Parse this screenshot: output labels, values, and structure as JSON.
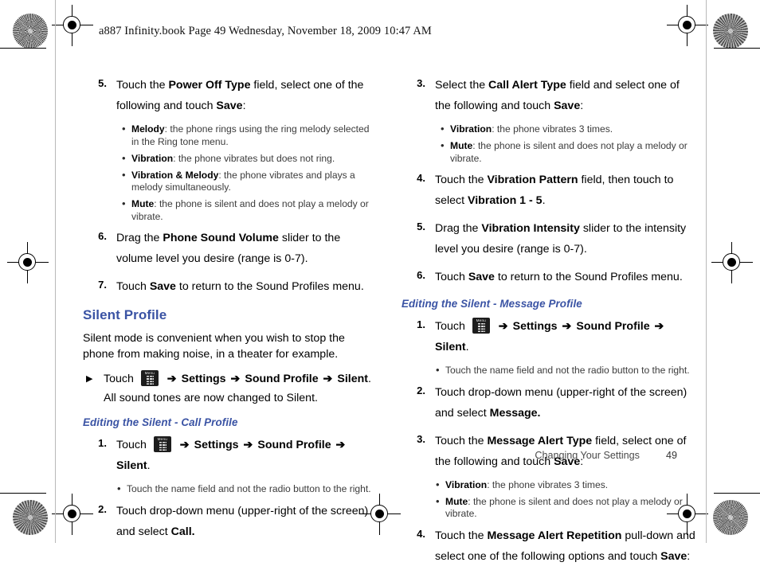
{
  "document": {
    "header": "a887 Infinity.book  Page 49  Wednesday, November 18, 2009  10:47 AM",
    "footer_title": "Changing Your Settings",
    "page_number": "49",
    "accent_color": "#3a53a4"
  },
  "left_column": {
    "steps": [
      {
        "num": "5.",
        "text_html": "Touch the <b class=\"bk\">Power Off Type</b> field, select one of the following and touch <b class=\"bk\">Save</b>:",
        "bullets": [
          {
            "term": "Melody",
            "desc": ": the phone rings using the ring melody selected in the Ring tone menu."
          },
          {
            "term": "Vibration",
            "desc": ": the phone vibrates but does not ring."
          },
          {
            "term": "Vibration & Melody",
            "desc": ": the phone vibrates and plays a melody simultaneously."
          },
          {
            "term": "Mute",
            "desc": ": the phone is silent and does not play a melody or vibrate."
          }
        ]
      },
      {
        "num": "6.",
        "text_html": "Drag the <b class=\"bk\">Phone Sound Volume</b> slider to the volume level you desire (range is 0-7).",
        "bullets": []
      },
      {
        "num": "7.",
        "text_html": "Touch <b class=\"bk\">Save</b> to return to the Sound Profiles menu.",
        "bullets": []
      }
    ],
    "silent_profile_heading": "Silent Profile",
    "silent_profile_para": "Silent mode is convenient when you wish to stop the phone from making noise, in a theater for example.",
    "arrow_step_html": "Touch <span class=\"menu-key\" data-name=\"menu-key-icon\"><span class=\"lbl\">Menu</span><span class=\"grid\"></span></span> <span class=\"arr\">➔</span> <b class=\"bk\">Settings</b> <span class=\"arr\">➔</span> <b class=\"bk\">Sound Profile</b> <span class=\"arr\">➔</span> <b class=\"bk\">Silent</b>.",
    "arrow_step_note": "All sound tones are now changed to Silent.",
    "call_profile_heading": "Editing the Silent - Call Profile",
    "call_profile_steps": [
      {
        "num": "1.",
        "text_html": "Touch <span class=\"menu-key\" data-name=\"menu-key-icon\"><span class=\"lbl\">Menu</span><span class=\"grid\"></span></span> <span class=\"arr\">➔</span> <b class=\"bk\">Settings</b> <span class=\"arr\">➔</span> <b class=\"bk\">Sound Profile</b> <span class=\"arr\">➔</span> <b class=\"bk\">Silent</b>.",
        "bullets": [
          {
            "term": "",
            "desc": "Touch the name field and not the radio button to the right."
          }
        ]
      },
      {
        "num": "2.",
        "text_html": "Touch drop-down menu (upper-right of the screen) and select <b class=\"bk\">Call.</b>",
        "bullets": []
      }
    ]
  },
  "right_column": {
    "steps": [
      {
        "num": "3.",
        "text_html": "Select the <b class=\"bk\">Call Alert Type</b> field and select one of the following and touch <b class=\"bk\">Save</b>:",
        "bullets": [
          {
            "term": "Vibration",
            "desc": ": the phone vibrates 3 times."
          },
          {
            "term": "Mute",
            "desc": ": the phone is silent and does not play a melody or vibrate."
          }
        ]
      },
      {
        "num": "4.",
        "text_html": "Touch the <b class=\"bk\">Vibration Pattern</b> field, then touch to select <b class=\"bk\">Vibration 1 - 5</b>.",
        "bullets": []
      },
      {
        "num": "5.",
        "text_html": "Drag the <b class=\"bk\">Vibration Intensity</b> slider to the intensity level you desire (range is 0-7).",
        "bullets": []
      },
      {
        "num": "6.",
        "text_html": "Touch <b class=\"bk\">Save</b> to return to the Sound Profiles menu.",
        "bullets": []
      }
    ],
    "message_profile_heading": "Editing the Silent - Message Profile",
    "message_profile_steps": [
      {
        "num": "1.",
        "text_html": "Touch <span class=\"menu-key\" data-name=\"menu-key-icon\"><span class=\"lbl\">Menu</span><span class=\"grid\"></span></span> <span class=\"arr\">➔</span> <b class=\"bk\">Settings</b> <span class=\"arr\">➔</span> <b class=\"bk\">Sound Profile</b> <span class=\"arr\">➔</span> <b class=\"bk\">Silent</b>.",
        "bullets": [
          {
            "term": "",
            "desc": "Touch the name field and not the radio button to the right."
          }
        ]
      },
      {
        "num": "2.",
        "text_html": "Touch drop-down menu (upper-right of the screen) and select <b class=\"bk\">Message.</b>",
        "bullets": []
      },
      {
        "num": "3.",
        "text_html": "Touch the <b class=\"bk\">Message Alert Type</b> field, select one of the following and touch <b class=\"bk\">Save</b>:",
        "bullets": [
          {
            "term": "Vibration",
            "desc": ": the phone vibrates 3 times."
          },
          {
            "term": "Mute",
            "desc": ": the phone is silent and does not play a melody or vibrate."
          }
        ]
      },
      {
        "num": "4.",
        "text_html": "Touch the <b class=\"bk\">Message Alert Repetition</b> pull-down and select one of the following options and touch <b class=\"bk\">Save</b>:",
        "bullets": []
      }
    ]
  }
}
